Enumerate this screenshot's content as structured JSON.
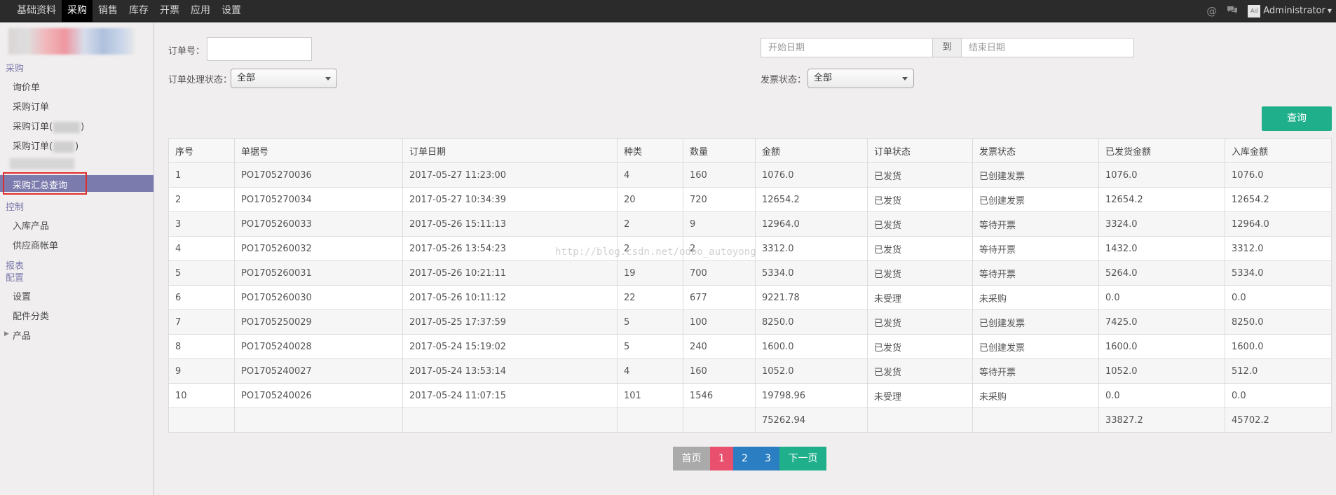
{
  "topbar": {
    "menu": [
      "基础资料",
      "采购",
      "销售",
      "库存",
      "开票",
      "应用",
      "设置"
    ],
    "active_index": 1,
    "user": "Administrator",
    "avatar_text": "Ad",
    "icons": [
      "at-icon",
      "chat-icon"
    ]
  },
  "sidebar": {
    "section_purchase": "采购",
    "item_inquiry": "询价单",
    "item_order": "采购订单",
    "item_order2_prefix": "采购订单(",
    "item_order2_suffix": ")",
    "item_order3_prefix": "采购订单(",
    "item_order3_suffix": ")",
    "item_summary": "采购汇总查询",
    "section_control": "控制",
    "item_inbound": "入库产品",
    "item_supplier": "供应商帐单",
    "section_report": "报表",
    "section_config": "配置",
    "item_settings": "设置",
    "item_parts": "配件分类",
    "item_product": "产品"
  },
  "filters": {
    "order_no_label": "订单号：",
    "order_no_value": "",
    "start_date_placeholder": "开始日期",
    "date_sep": "到",
    "end_date_placeholder": "结束日期",
    "status_label": "订单处理状态：",
    "status_value": "全部",
    "invoice_label": "发票状态：",
    "invoice_value": "全部",
    "query_button": "查询"
  },
  "table": {
    "headers": [
      "序号",
      "单据号",
      "订单日期",
      "种类",
      "数量",
      "金额",
      "订单状态",
      "发票状态",
      "已发货金额",
      "入库金额"
    ],
    "rows": [
      [
        "1",
        "PO1705270036",
        "2017-05-27 11:23:00",
        "4",
        "160",
        "1076.0",
        "已发货",
        "已创建发票",
        "1076.0",
        "1076.0"
      ],
      [
        "2",
        "PO1705270034",
        "2017-05-27 10:34:39",
        "20",
        "720",
        "12654.2",
        "已发货",
        "已创建发票",
        "12654.2",
        "12654.2"
      ],
      [
        "3",
        "PO1705260033",
        "2017-05-26 15:11:13",
        "2",
        "9",
        "12964.0",
        "已发货",
        "等待开票",
        "3324.0",
        "12964.0"
      ],
      [
        "4",
        "PO1705260032",
        "2017-05-26 13:54:23",
        "2",
        "2",
        "3312.0",
        "已发货",
        "等待开票",
        "1432.0",
        "3312.0"
      ],
      [
        "5",
        "PO1705260031",
        "2017-05-26 10:21:11",
        "19",
        "700",
        "5334.0",
        "已发货",
        "等待开票",
        "5264.0",
        "5334.0"
      ],
      [
        "6",
        "PO1705260030",
        "2017-05-26 10:11:12",
        "22",
        "677",
        "9221.78",
        "未受理",
        "未采购",
        "0.0",
        "0.0"
      ],
      [
        "7",
        "PO1705250029",
        "2017-05-25 17:37:59",
        "5",
        "100",
        "8250.0",
        "已发货",
        "已创建发票",
        "7425.0",
        "8250.0"
      ],
      [
        "8",
        "PO1705240028",
        "2017-05-24 15:19:02",
        "5",
        "240",
        "1600.0",
        "已发货",
        "已创建发票",
        "1600.0",
        "1600.0"
      ],
      [
        "9",
        "PO1705240027",
        "2017-05-24 13:53:14",
        "4",
        "160",
        "1052.0",
        "已发货",
        "等待开票",
        "1052.0",
        "512.0"
      ],
      [
        "10",
        "PO1705240026",
        "2017-05-24 11:07:15",
        "101",
        "1546",
        "19798.96",
        "未受理",
        "未采购",
        "0.0",
        "0.0"
      ]
    ],
    "totals": [
      "",
      "",
      "",
      "",
      "",
      "75262.94",
      "",
      "",
      "33827.2",
      "45702.2"
    ]
  },
  "watermark": "http://blog.csdn.net/odoo_autoyong",
  "pagination": {
    "first": "首页",
    "pages": [
      "1",
      "2",
      "3"
    ],
    "next": "下一页"
  },
  "colors": {
    "accent": "#7c7bad",
    "query": "#1fb08b",
    "page_active": "#e9506e",
    "page": "#2b7ec1",
    "highlight": "#e02d2d"
  }
}
